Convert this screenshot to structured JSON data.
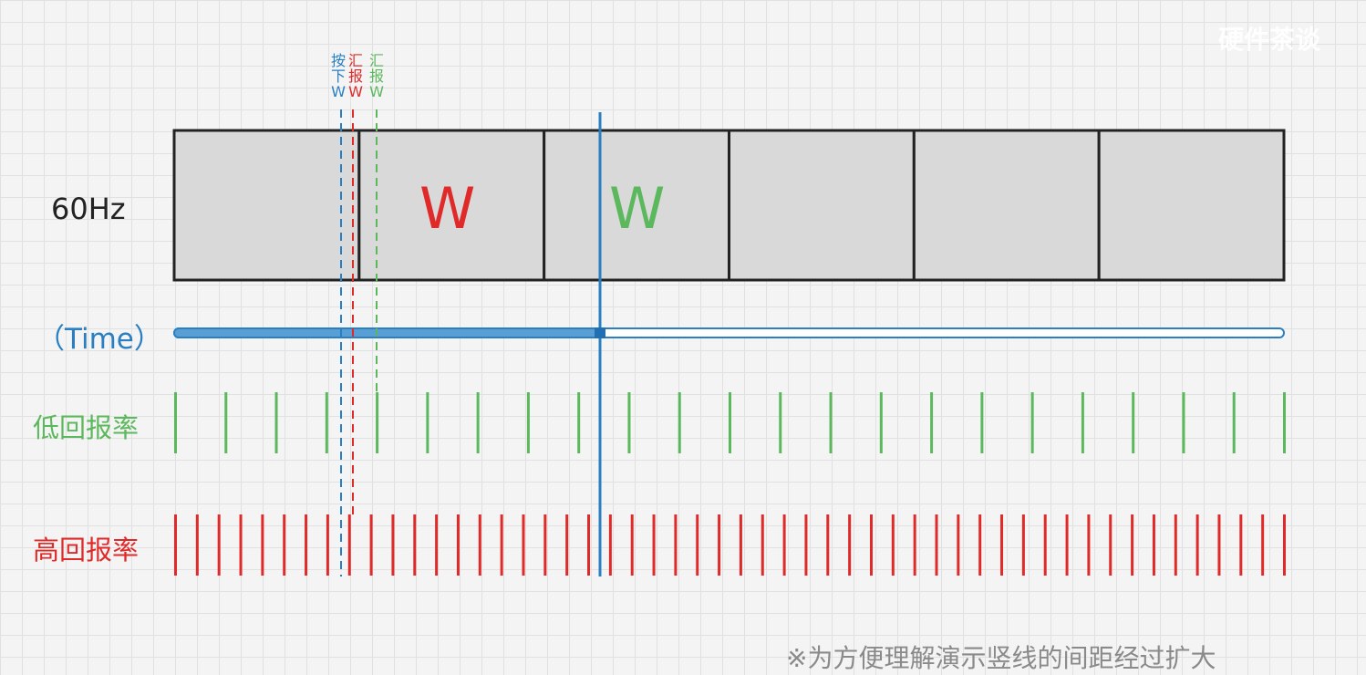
{
  "watermark": "硬件茶谈",
  "frame_label": "60Hz",
  "time_label": "（Time）",
  "low_rate_label": "低回报率",
  "high_rate_label": "高回报率",
  "footnote": "※为方便理解演示竖线的间距经过扩大",
  "markers": {
    "press": {
      "chars": [
        "按",
        "下",
        "W"
      ],
      "color": "#2a7fc2"
    },
    "report_high": {
      "chars": [
        "汇",
        "报",
        "W"
      ],
      "color": "#e02a2a"
    },
    "report_low": {
      "chars": [
        "汇",
        "报",
        "W"
      ],
      "color": "#5cb85c"
    }
  },
  "frames": {
    "count": 6,
    "letters": [
      {
        "frame": 2,
        "text": "W",
        "color": "#e02a2a"
      },
      {
        "frame": 3,
        "text": "W",
        "color": "#5cb85c"
      }
    ]
  },
  "colors": {
    "blue": "#2a7fc2",
    "red": "#e02a2a",
    "green": "#5cb85c",
    "frame_fill": "#d9d9d9",
    "frame_stroke": "#222222"
  },
  "ticks": {
    "low_count": 23,
    "high_count": 52
  }
}
